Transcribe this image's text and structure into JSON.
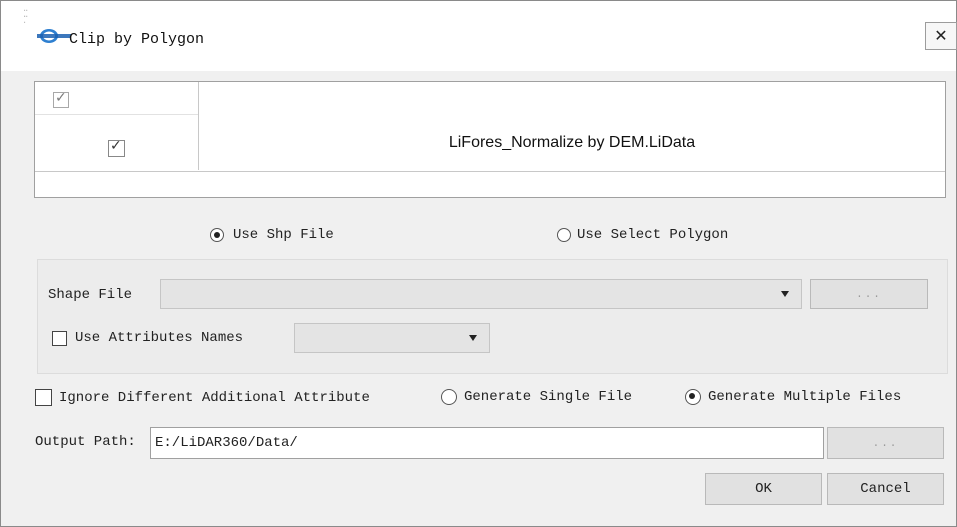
{
  "dialog": {
    "title": "Clip by Polygon",
    "close_label": "✕"
  },
  "table": {
    "rows": [
      {
        "checked": true,
        "file": "LiFores_Normalize by DEM.LiData"
      }
    ]
  },
  "mode": {
    "use_shp_file": "Use Shp File",
    "use_select_polygon": "Use Select Polygon",
    "selected": "use_shp_file"
  },
  "shape_group": {
    "shape_file_label": "Shape File",
    "shape_file_value": "",
    "browse_label": "...",
    "use_attr_label": "Use Attributes Names",
    "use_attr_checked": false,
    "attr_value": ""
  },
  "options": {
    "ignore_label": "Ignore Different Additional Attribute",
    "ignore_checked": false,
    "single_label": "Generate Single File",
    "multiple_label": "Generate Multiple Files",
    "selected": "multiple"
  },
  "output": {
    "label": "Output Path:",
    "value": "E:/LiDAR360/Data/",
    "browse_label": "..."
  },
  "buttons": {
    "ok": "OK",
    "cancel": "Cancel"
  }
}
